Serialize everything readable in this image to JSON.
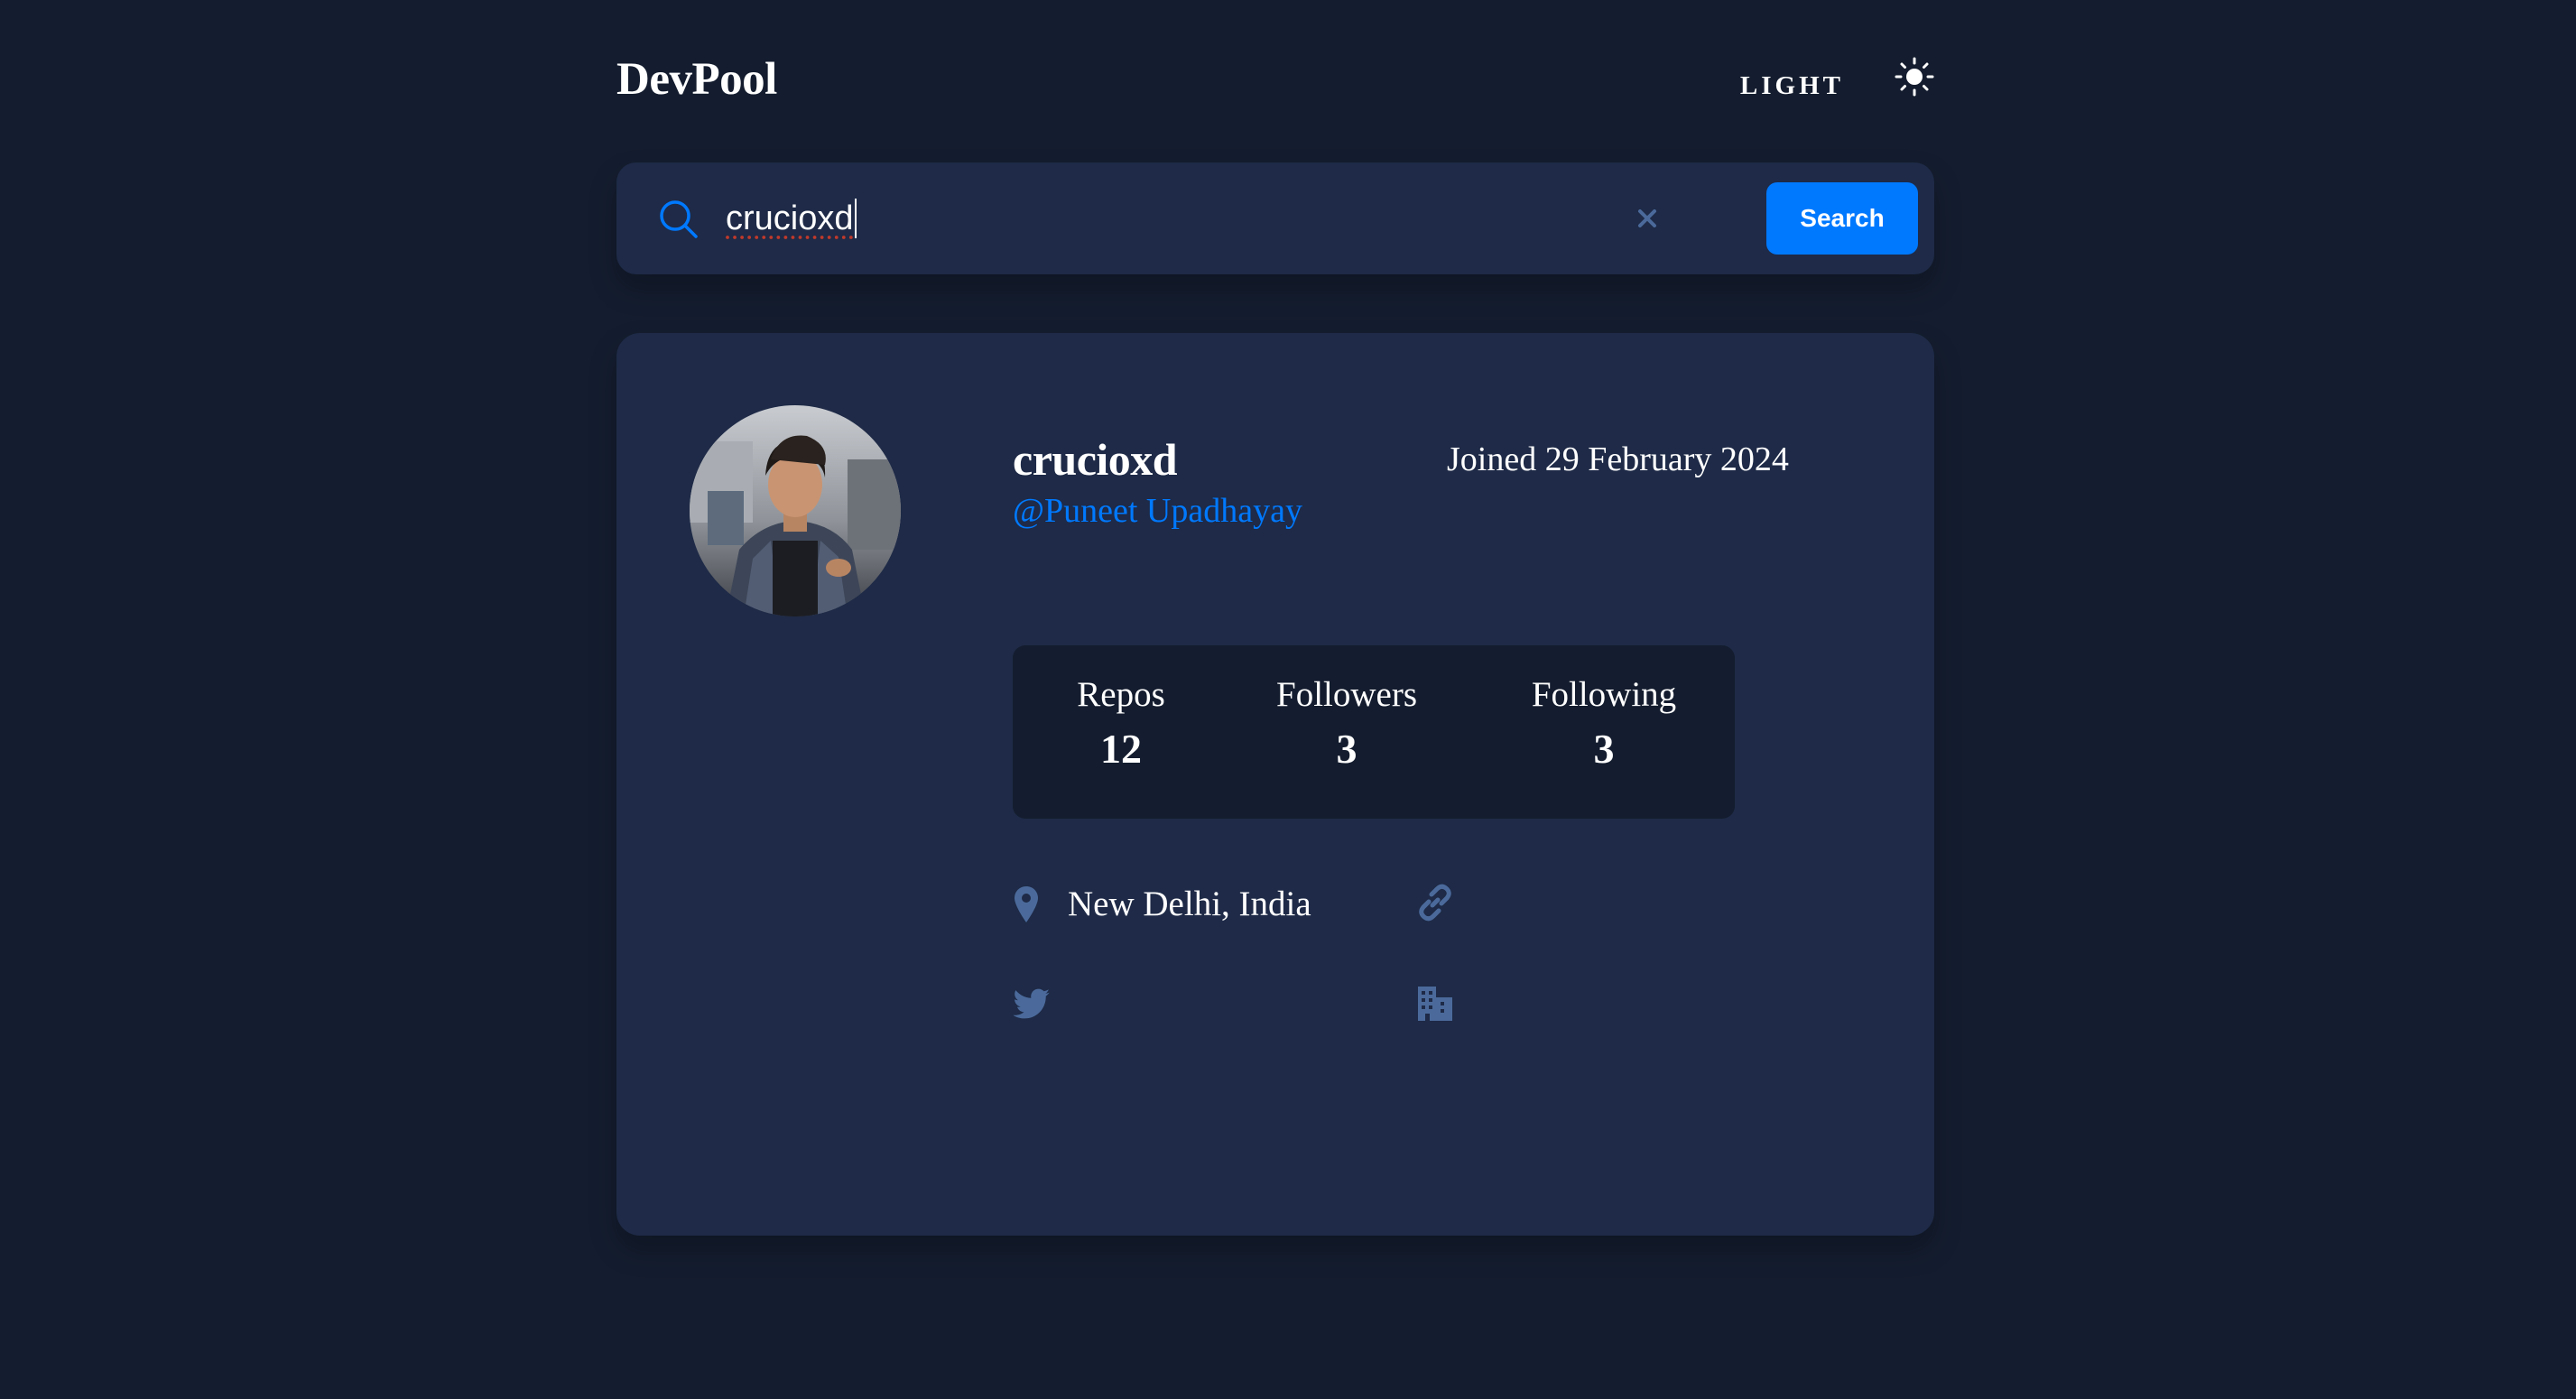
{
  "header": {
    "logo": "DevPool",
    "theme_label": "LIGHT",
    "theme_icon": "sun-icon"
  },
  "search": {
    "value": "crucioxd",
    "button_label": "Search",
    "search_icon": "search-icon",
    "clear_icon": "close-icon"
  },
  "profile": {
    "username": "crucioxd",
    "handle": "@Puneet Upadhayay",
    "joined": "Joined 29 February 2024",
    "stats": [
      {
        "label": "Repos",
        "value": "12"
      },
      {
        "label": "Followers",
        "value": "3"
      },
      {
        "label": "Following",
        "value": "3"
      }
    ],
    "location": "New Delhi, India",
    "icons": {
      "location": "location-pin-icon",
      "website": "link-icon",
      "twitter": "twitter-icon",
      "company": "building-icon"
    }
  },
  "colors": {
    "background": "#141d2f",
    "card": "#1e2a47",
    "accent": "#0079ff",
    "muted_icon": "#4b6a9b",
    "text": "#ffffff"
  }
}
